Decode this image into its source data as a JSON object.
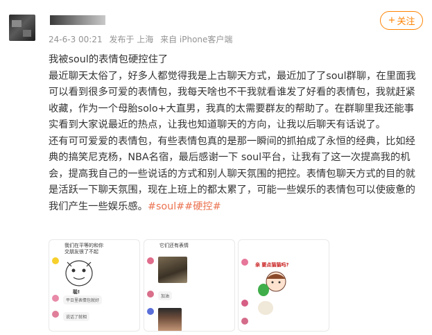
{
  "post": {
    "meta": {
      "time": "24-6-3 00:21",
      "posted_from": "发布于 上海",
      "client": "来自 iPhone客户端"
    },
    "follow_label": "关注",
    "title": "我被soul的表情包硬控住了",
    "paragraph1": "最近聊天太俗了，好多人都觉得我是上古聊天方式，最近加了了soul群聊，在里面我可以看到很多可爱的表情包，我每天啥也不干我就看谁发了好看的表情包，我就赶紧收藏，作为一个母胎solo+大直男，我真的太需要群友的帮助了。在群聊里我还能事实看到大家说最近的热点，让我也知道聊天的方向，让我以后聊天有话说了。",
    "paragraph2": "还有可可爱爱的表情包，有些表情包真的是那一瞬间的抓拍成了永恒的经典，比如经典的搞笑尼克杨，NBA名宿，最后感谢一下 soul平台，让我有了这一次提高我的机会，提高我自己的一些说话的方式和别人聊天氛围的把控。表情包聊天方式的目的就是活跃一下聊天氛围，现在上班上的都太累了，可能一些娱乐的表情包可以使疲惫的我们产生一些娱乐感。",
    "hashtags": "#soul##硬控#"
  },
  "images": [
    {
      "caption_top": "我们在平等的和你",
      "caption_top2": "交朋友很了不起",
      "sticker_text": "聪!",
      "bubble1": "平日里表情包就好",
      "bubble2": "说话了就相"
    },
    {
      "caption_top": "它们还有表情",
      "bubble1": "加油"
    },
    {
      "sticker_text": "亲 要点猫猫吗?"
    }
  ],
  "colors": {
    "accent": "#ff8200",
    "hashtag": "#eb7350",
    "meta": "#939393"
  }
}
